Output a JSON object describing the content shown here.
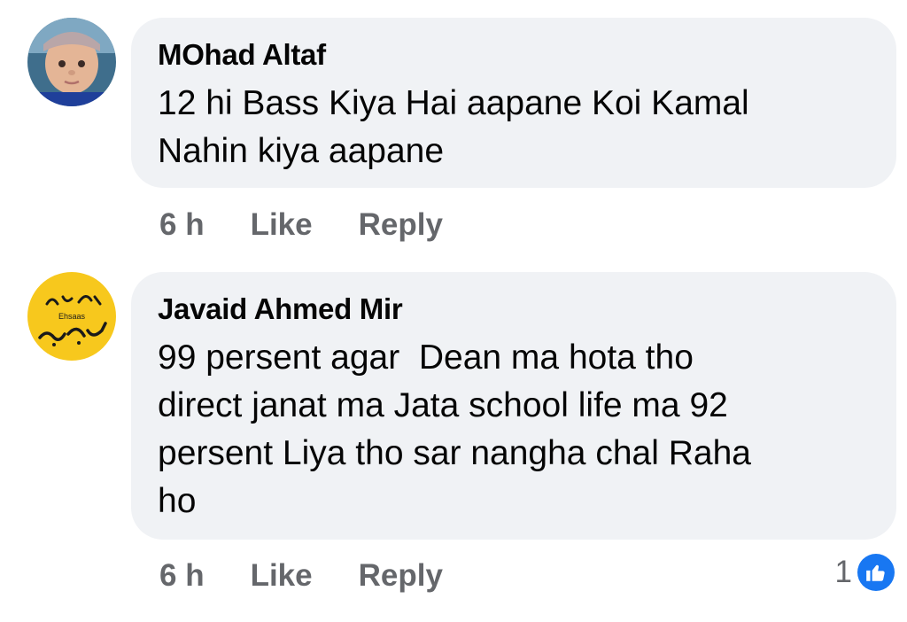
{
  "comments": [
    {
      "author": "MOhad Altaf",
      "text": "12 hi Bass Kiya Hai aapane Koi Kamal\nNahin kiya aapane",
      "time": "6 h",
      "like_label": "Like",
      "reply_label": "Reply",
      "avatar_icon": "baby-photo-avatar"
    },
    {
      "author": "Javaid Ahmed Mir",
      "text": "99 persent agar  Dean ma hota tho\ndirect janat ma Jata school life ma 92\npersent Liya tho sar nangha chal Raha\nho",
      "time": "6 h",
      "like_label": "Like",
      "reply_label": "Reply",
      "reaction_count": "1",
      "avatar_icon": "urdu-calligraphy-avatar",
      "avatar_text": "Ehsaas",
      "reaction_icon": "thumbs-up-icon"
    }
  ],
  "colors": {
    "bubble": "#f0f2f5",
    "secondary_text": "#65676b",
    "like_blue": "#1877f2",
    "avatar2_yellow": "#f7c81d"
  }
}
